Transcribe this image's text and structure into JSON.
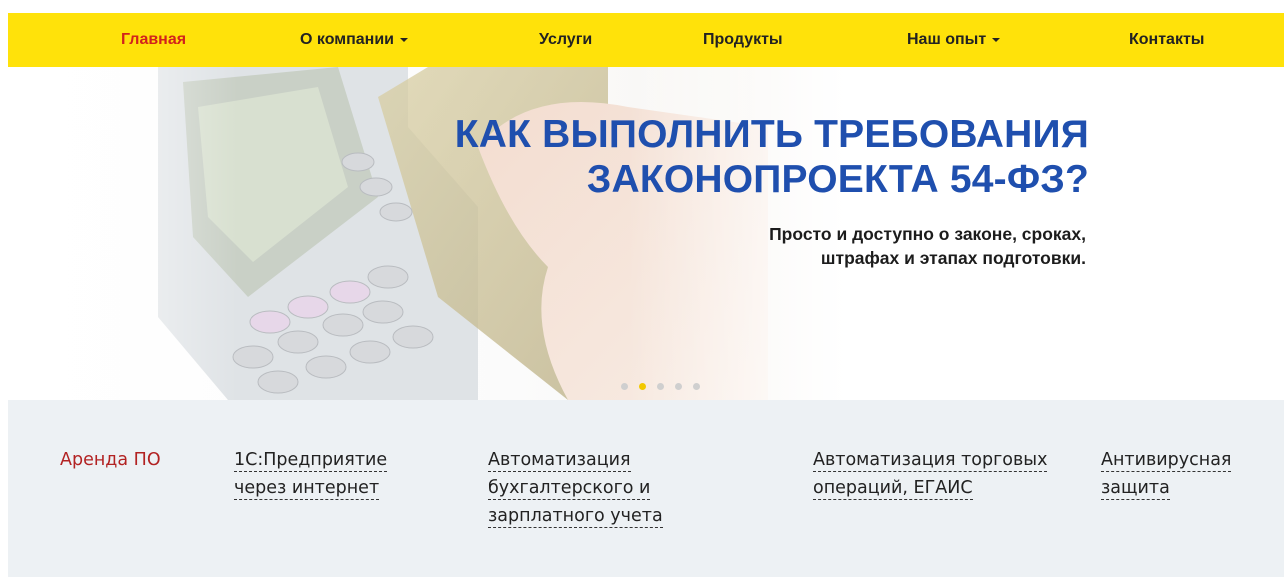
{
  "nav": {
    "items": [
      {
        "label": "Главная",
        "active": true,
        "dropdown": false
      },
      {
        "label": "О компании",
        "active": false,
        "dropdown": true
      },
      {
        "label": "Услуги",
        "active": false,
        "dropdown": false
      },
      {
        "label": "Продукты",
        "active": false,
        "dropdown": false
      },
      {
        "label": "Наш опыт",
        "active": false,
        "dropdown": true
      },
      {
        "label": "Контакты",
        "active": false,
        "dropdown": false
      }
    ],
    "background": "#ffe20a",
    "active_color": "#d2231c"
  },
  "banner": {
    "title_line1": "КАК ВЫПОЛНИТЬ ТРЕБОВАНИЯ",
    "title_line2": "ЗАКОНОПРОЕКТА 54-ФЗ?",
    "subtitle_line1": "Просто и доступно о законе, сроках,",
    "subtitle_line2": "штрафах и этапах подготовки.",
    "title_color": "#1f4fae",
    "slides_total": 5,
    "active_slide": 2
  },
  "services": {
    "items": [
      {
        "lines": [
          "Аренда ПО"
        ]
      },
      {
        "lines": [
          "1С:Предприятие",
          "через интернет"
        ]
      },
      {
        "lines": [
          "Автоматизация",
          "бухгалтерского и",
          "зарплатного учета"
        ]
      },
      {
        "lines": [
          "Автоматизация торговых",
          "операций, ЕГАИС"
        ]
      },
      {
        "lines": [
          "Антивирусная",
          "защита"
        ]
      }
    ],
    "first_item_color": "#b22222"
  }
}
